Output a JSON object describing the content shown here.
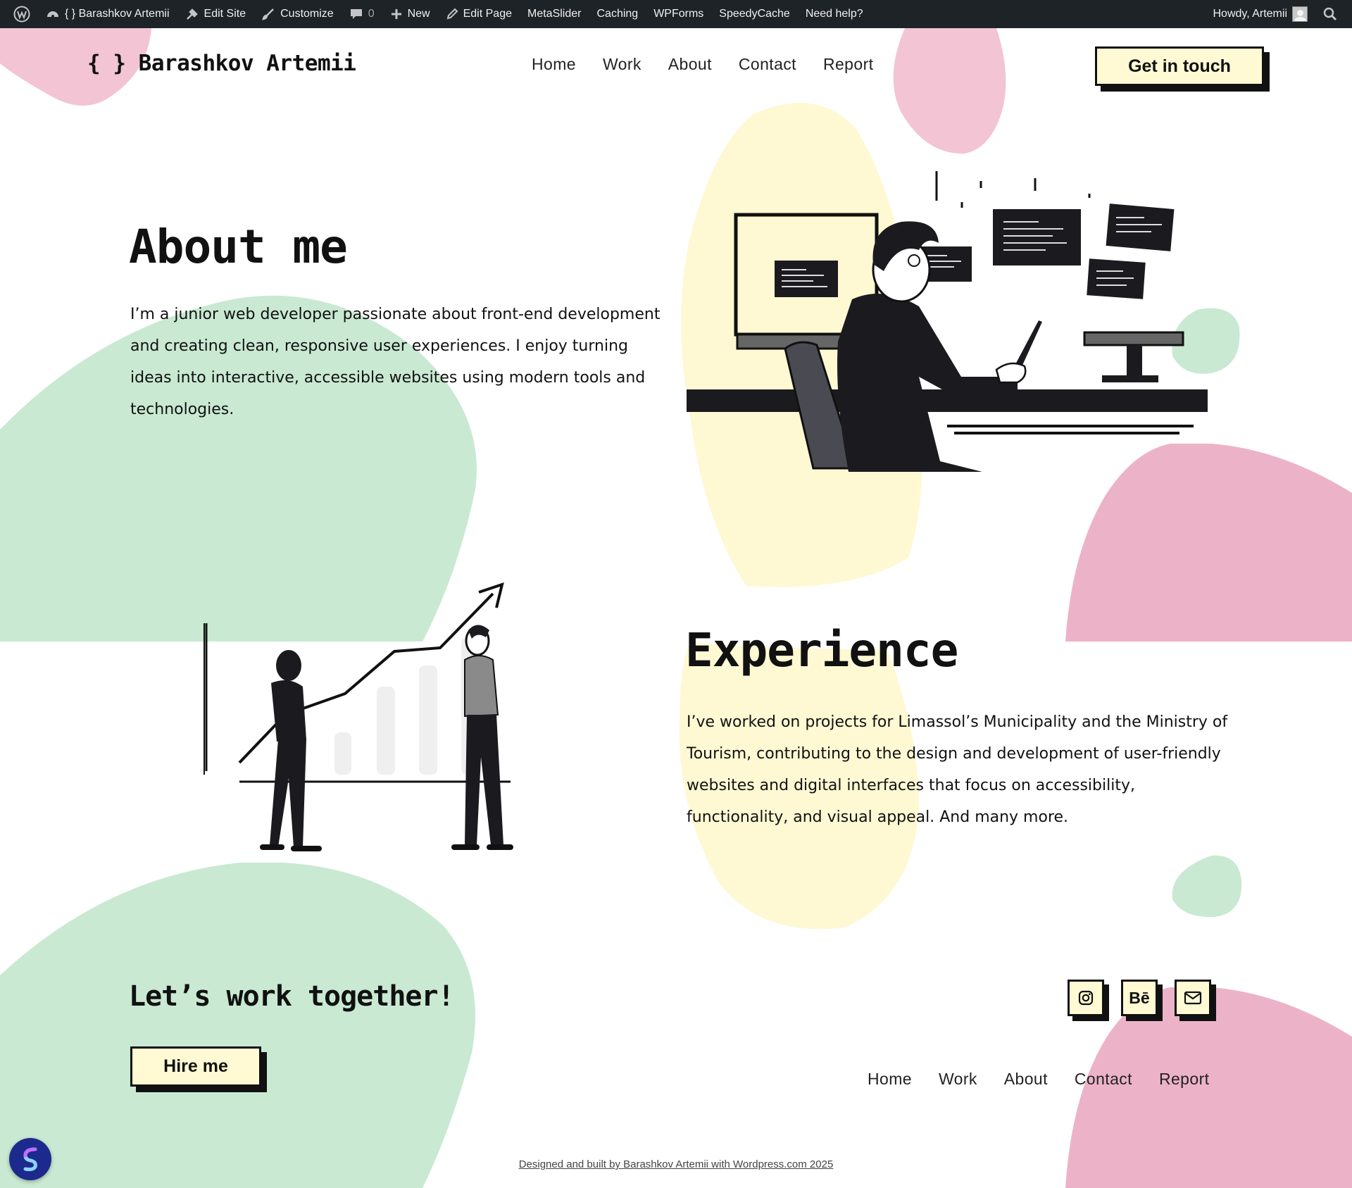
{
  "admin_bar": {
    "site_name": "{ } Barashkov Artemii",
    "edit_site": "Edit Site",
    "customize": "Customize",
    "comments_count": "0",
    "new": "New",
    "edit_page": "Edit Page",
    "metaslider": "MetaSlider",
    "caching": "Caching",
    "wpforms": "WPForms",
    "speedycache": "SpeedyCache",
    "need_help": "Need help?",
    "howdy": "Howdy, Artemii"
  },
  "header": {
    "logo": "{ } Barashkov Artemii",
    "nav": [
      "Home",
      "Work",
      "About",
      "Contact",
      "Report"
    ],
    "cta": "Get in touch"
  },
  "about": {
    "title": "About me",
    "text": "I’m a junior web developer passionate about front-end development and creating clean, responsive user experiences. I enjoy turning ideas into interactive, accessible websites using modern tools and technologies."
  },
  "experience": {
    "title": "Experience",
    "text": "I’ve worked on projects for Limassol’s Municipality and the Ministry of Tourism, contributing to the design and development of user-friendly websites and digital interfaces that focus on accessibility, functionality, and visual appeal. And many more."
  },
  "footer": {
    "title": "Let’s work together!",
    "cta": "Hire me",
    "social": [
      "instagram-icon",
      "Bē",
      "mail-icon"
    ],
    "nav": [
      "Home",
      "Work",
      "About",
      "Contact",
      "Report"
    ],
    "credit": "Designed and built by Barashkov Artemii with Wordpress.com 2025"
  },
  "colors": {
    "pink": "#f2c4d4",
    "pink_dark": "#ecb3c8",
    "green": "#c9e9d2",
    "yellow": "#fef9d3",
    "cream_button": "#fffad3",
    "admin_bar": "#1d2327"
  }
}
